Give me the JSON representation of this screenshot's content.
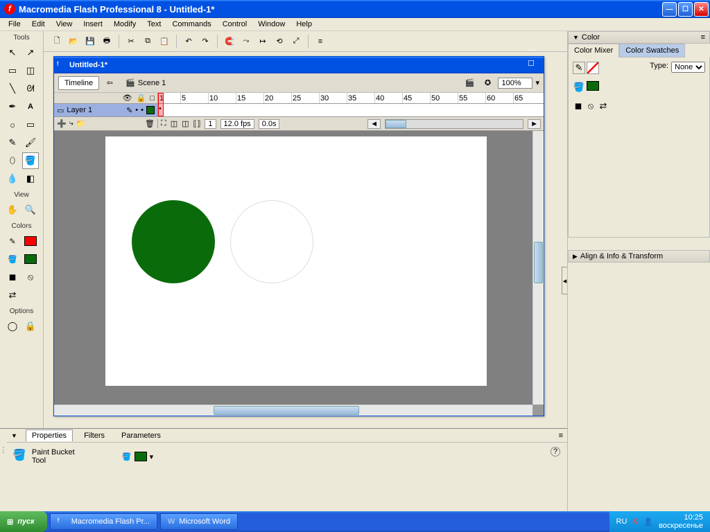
{
  "app": {
    "title": "Macromedia Flash Professional 8 - Untitled-1*"
  },
  "menu": [
    "File",
    "Edit",
    "View",
    "Insert",
    "Modify",
    "Text",
    "Commands",
    "Control",
    "Window",
    "Help"
  ],
  "tools": {
    "heading": "Tools",
    "view_heading": "View",
    "colors_heading": "Colors",
    "options_heading": "Options"
  },
  "document": {
    "title": "Untitled-1*",
    "timeline_btn": "Timeline",
    "scene": "Scene 1",
    "zoom": "100%",
    "layer": "Layer 1",
    "ruler_ticks": [
      1,
      5,
      10,
      15,
      20,
      25,
      30,
      35,
      40,
      45,
      50,
      55,
      60,
      65
    ],
    "frame": "1",
    "fps": "12.0 fps",
    "time": "0.0s"
  },
  "props": {
    "tabs": [
      "Properties",
      "Filters",
      "Parameters"
    ],
    "tool_name": "Paint Bucket Tool"
  },
  "right": {
    "color": "Color",
    "mixer": "Color Mixer",
    "swatches": "Color Swatches",
    "type_label": "Type:",
    "type_value": "None",
    "align": "Align & Info & Transform"
  },
  "taskbar": {
    "start": "пуск",
    "items": [
      "Macromedia Flash Pr...",
      "Microsoft Word"
    ],
    "lang": "RU",
    "time": "10:25",
    "day": "воскресенье"
  }
}
